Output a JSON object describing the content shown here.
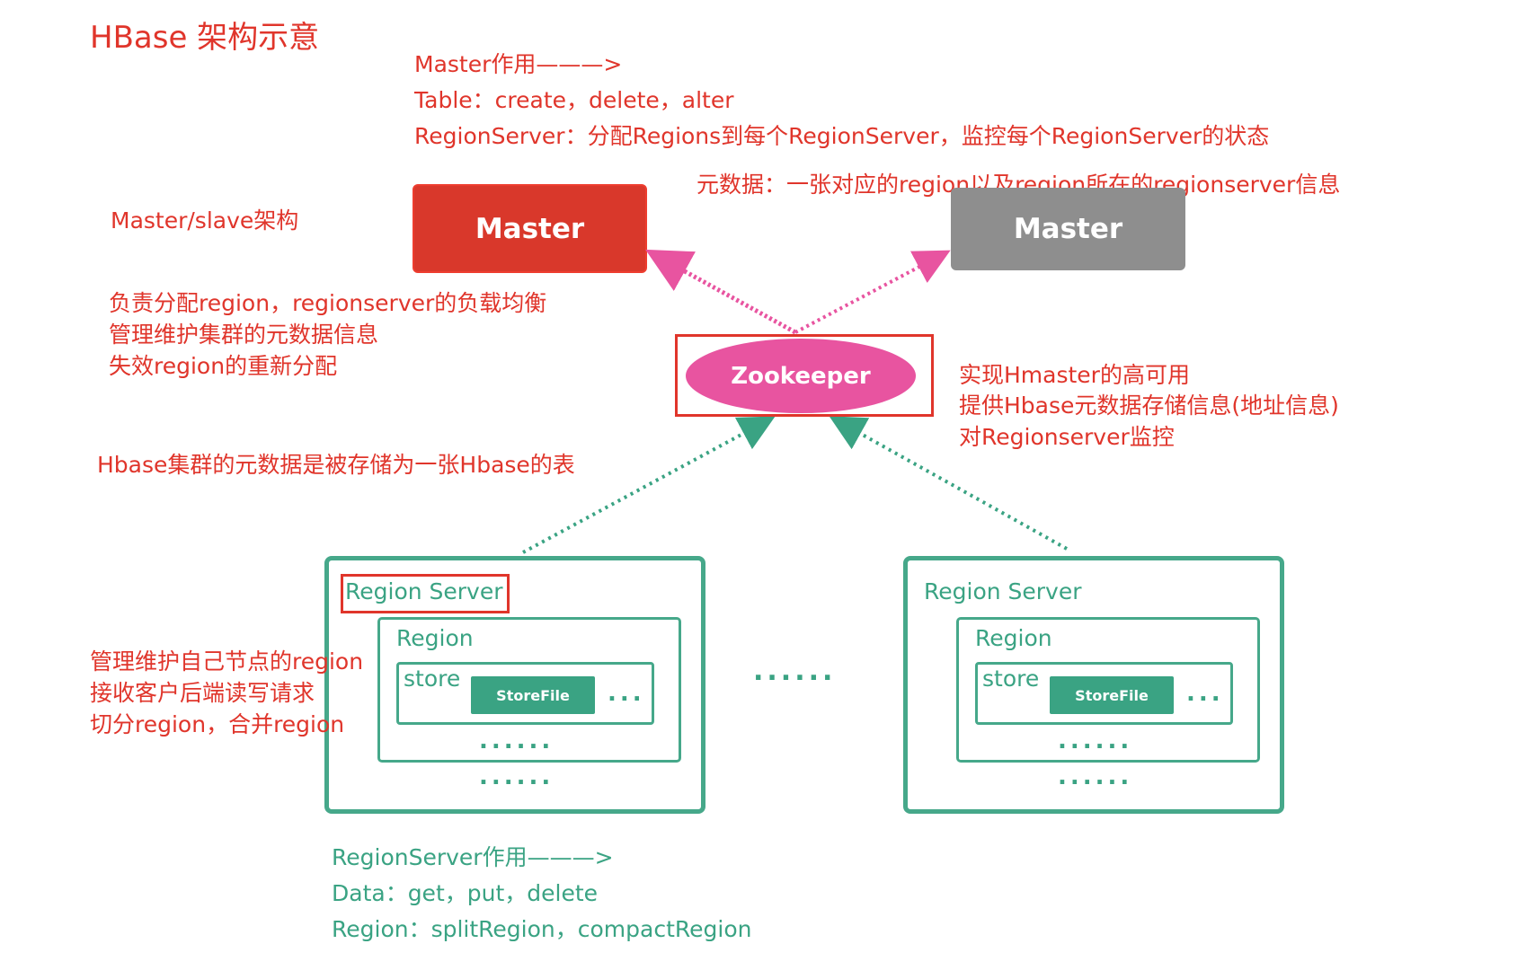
{
  "title": "HBase 架构示意",
  "master_role": {
    "heading": "Master作用———>",
    "table": "Table：create，delete，alter",
    "regionserver": "RegionServer：分配Regions到每个RegionServer，监控每个RegionServer的状态"
  },
  "metadata_note": "元数据：一张对应的region以及region所在的regionserver信息",
  "master_slave": "Master/slave架构",
  "master_duties": [
    "负责分配region，regionserver的负载均衡",
    "管理维护集群的元数据信息",
    "失效region的重新分配"
  ],
  "master_active_label": "Master",
  "master_standby_label": "Master",
  "zookeeper_label": "Zookeeper",
  "zookeeper_duties": [
    "实现Hmaster的高可用",
    "提供Hbase元数据存储信息(地址信息)",
    "对Regionserver监控"
  ],
  "meta_table_note": "Hbase集群的元数据是被存储为一张Hbase的表",
  "region_servers": [
    {
      "label": "Region Server",
      "region_label": "Region",
      "store_label": "store",
      "storefile_label": "StoreFile",
      "store_more": "...",
      "region_more": "......",
      "server_more": "......"
    },
    {
      "label": "Region Server",
      "region_label": "Region",
      "store_label": "store",
      "storefile_label": "StoreFile",
      "store_more": "...",
      "region_more": "......",
      "server_more": "......"
    }
  ],
  "between_servers": "......",
  "regionserver_duties": [
    "管理维护自己节点的region",
    "接收客户后端读写请求",
    "切分region，合并region"
  ],
  "regionserver_role": {
    "heading": "RegionServer作用———>",
    "data": "Data：get，put，delete",
    "region": "Region：splitRegion，compactRegion"
  },
  "colors": {
    "annotation_red": "#e0352b",
    "master_active": "#d9382b",
    "master_standby": "#8e8e8e",
    "zookeeper": "#e854a0",
    "region_green": "#46a88a",
    "arrow_pink": "#e854a0",
    "arrow_green": "#3aa383"
  }
}
